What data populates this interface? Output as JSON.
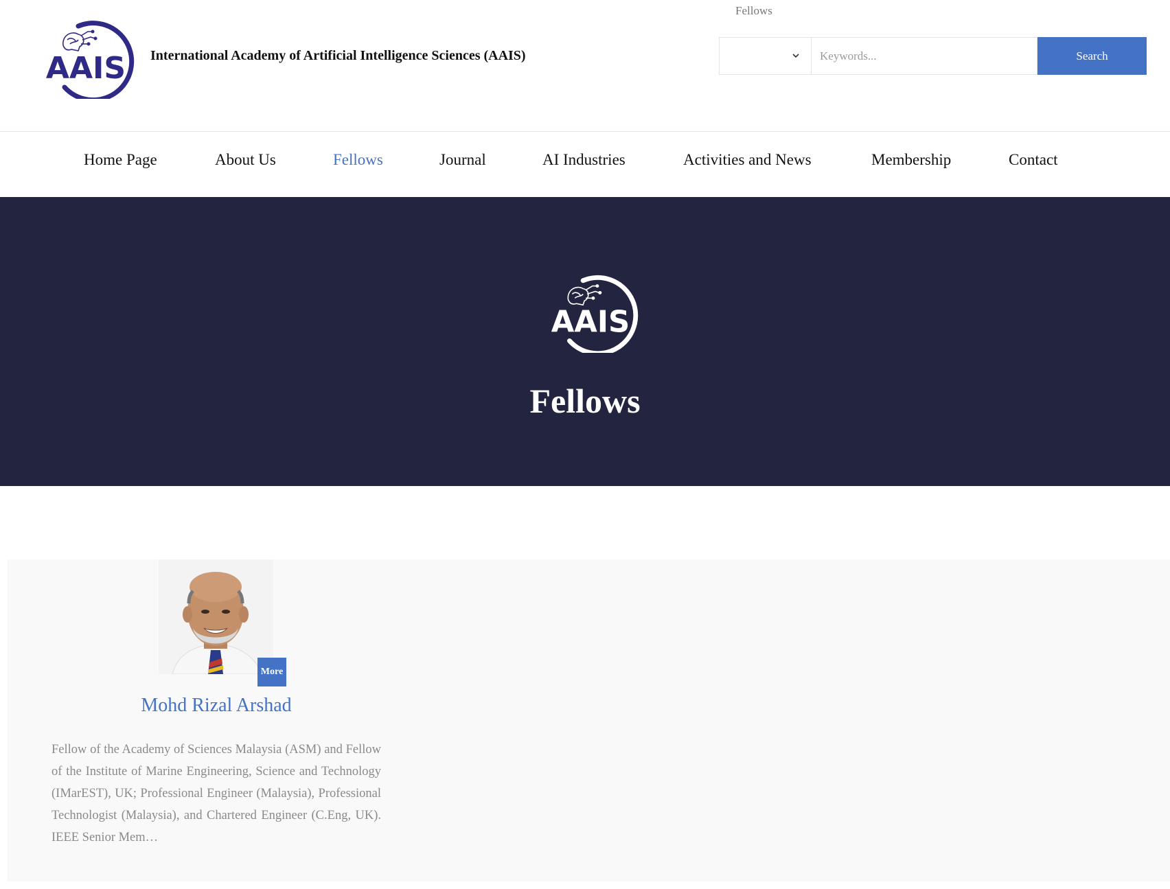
{
  "header": {
    "site_title": "International Academy of Artificial Intelligence Sciences (AAIS)",
    "breadcrumb": "Fellows",
    "logo_text": "AAIS",
    "search": {
      "select_value": "",
      "placeholder": "Keywords...",
      "button_label": "Search"
    }
  },
  "nav": {
    "items": [
      {
        "label": "Home Page"
      },
      {
        "label": "About Us"
      },
      {
        "label": "Fellows"
      },
      {
        "label": "Journal"
      },
      {
        "label": "AI Industries"
      },
      {
        "label": "Activities and News"
      },
      {
        "label": "Membership"
      },
      {
        "label": "Contact"
      }
    ],
    "active": "Fellows"
  },
  "banner": {
    "logo_text": "AAIS",
    "title": "Fellows"
  },
  "fellows": [
    {
      "name": "Mohd Rizal Arshad",
      "more_label": "More",
      "description": "Fellow of the Academy of Sciences Malaysia (ASM) and Fellow of the Institute of Marine Engineering, Science and Technology (IMarEST), UK; Professional Engineer (Malaysia), Professional Technologist (Malaysia), and Chartered Engineer (C.Eng, UK). IEEE Senior Mem…"
    }
  ],
  "colors": {
    "accent": "#4472c4",
    "banner_bg": "#232540",
    "logo_purple": "#2e2a86",
    "content_bg": "#f9f9f9"
  },
  "icons": {
    "select": "chevron-down-icon",
    "logo": "brain-circuit-logo"
  }
}
